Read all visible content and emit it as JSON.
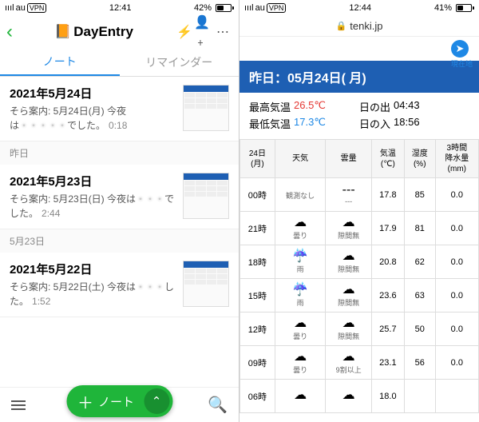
{
  "left": {
    "status": {
      "carrier": "au",
      "signal": "ıııl",
      "vpn": "VPN",
      "time": "12:41",
      "battery_pct": "42%",
      "battery_fill": 42
    },
    "header": {
      "back": "‹",
      "title": "DayEntry",
      "icons": [
        "⚡",
        "👤+",
        "⋯"
      ]
    },
    "tabs": {
      "notes": "ノート",
      "reminders": "リマインダー"
    },
    "entries": [
      {
        "title": "2021年5月24日",
        "sub_pre": "そら案内: 5月24日(月) 今夜は",
        "sub_blur": "・・・・・",
        "sub_post": "でした。",
        "time": "0:18"
      },
      {
        "title": "2021年5月23日",
        "sub_pre": "そら案内: 5月23日(日) 今夜は",
        "sub_blur": "・・・",
        "sub_post": "でした。",
        "time": "2:44"
      },
      {
        "title": "2021年5月22日",
        "sub_pre": "そら案内: 5月22日(土) 今夜は",
        "sub_blur": "・・・",
        "sub_post": "した。",
        "time": "1:52"
      }
    ],
    "dividers": {
      "yesterday": "昨日",
      "may23": "5月23日"
    },
    "fab": {
      "plus": "＋",
      "label": "ノート",
      "chev": "⌃"
    }
  },
  "right": {
    "status": {
      "carrier": "au",
      "signal": "ıııl",
      "vpn": "VPN",
      "time": "12:44",
      "battery_pct": "41%",
      "battery_fill": 41
    },
    "url": "tenki.jp",
    "loc_label": "現在地",
    "date_bar": "昨日：05月24日( 月)",
    "summary": {
      "hi_label": "最高気温",
      "hi_val": "26.5℃",
      "lo_label": "最低気温",
      "lo_val": "17.3℃",
      "sunrise_label": "日の出",
      "sunrise_val": "04:43",
      "sunset_label": "日の入",
      "sunset_val": "18:56"
    },
    "table": {
      "headers": [
        "24日\n(月)",
        "天気",
        "雲量",
        "気温\n(℃)",
        "湿度\n(%)",
        "3時間\n降水量\n(mm)"
      ],
      "rows": [
        {
          "time": "00時",
          "weather_icon": "",
          "weather_lbl": "観測なし",
          "cloud_icon": "---",
          "cloud_lbl": "---",
          "temp": "17.8",
          "hum": "85",
          "rain": "0.0"
        },
        {
          "time": "21時",
          "weather_icon": "☁",
          "weather_lbl": "曇り",
          "cloud_icon": "☁",
          "cloud_lbl": "隙間無",
          "temp": "17.9",
          "hum": "81",
          "rain": "0.0"
        },
        {
          "time": "18時",
          "weather_icon": "☔",
          "weather_lbl": "雨",
          "cloud_icon": "☁",
          "cloud_lbl": "隙間無",
          "temp": "20.8",
          "hum": "62",
          "rain": "0.0"
        },
        {
          "time": "15時",
          "weather_icon": "☔",
          "weather_lbl": "雨",
          "cloud_icon": "☁",
          "cloud_lbl": "隙間無",
          "temp": "23.6",
          "hum": "63",
          "rain": "0.0"
        },
        {
          "time": "12時",
          "weather_icon": "☁",
          "weather_lbl": "曇り",
          "cloud_icon": "☁",
          "cloud_lbl": "隙間無",
          "temp": "25.7",
          "hum": "50",
          "rain": "0.0"
        },
        {
          "time": "09時",
          "weather_icon": "☁",
          "weather_lbl": "曇り",
          "cloud_icon": "☁",
          "cloud_lbl": "9割以上",
          "temp": "23.1",
          "hum": "56",
          "rain": "0.0"
        },
        {
          "time": "06時",
          "weather_icon": "☁",
          "weather_lbl": "",
          "cloud_icon": "☁",
          "cloud_lbl": "",
          "temp": "18.0",
          "hum": "",
          "rain": ""
        }
      ]
    }
  }
}
